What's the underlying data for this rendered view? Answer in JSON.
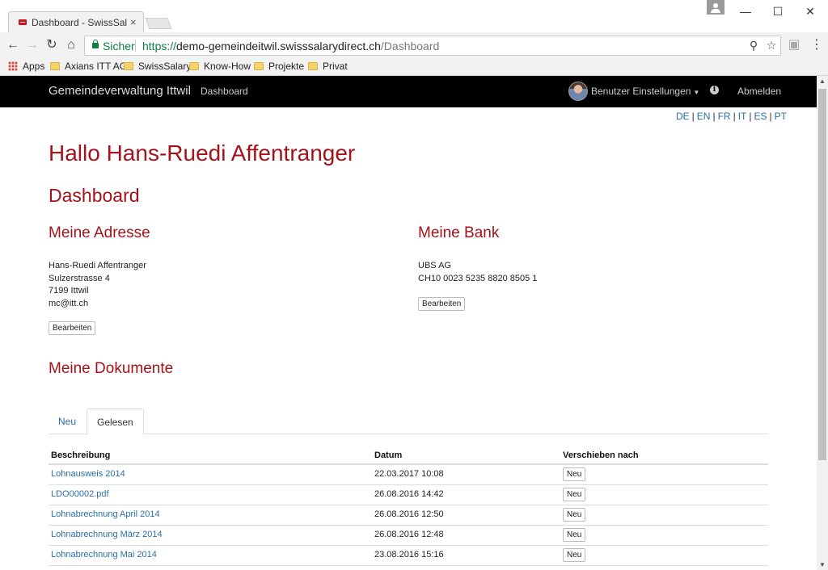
{
  "browser": {
    "tab_title": "Dashboard - SwissSalary",
    "tab_close": "×",
    "url_secure_label": "Sicher",
    "url_protocol": "https://",
    "url_host": "demo-gemeindeitwil.swisssalarydirect.ch",
    "url_path": "/Dashboard",
    "bookmarks": [
      "Apps",
      "Axians ITT AG",
      "SwissSalary",
      "Know-How",
      "Projekte",
      "Privat"
    ]
  },
  "navbar": {
    "brand": "Gemeindeverwaltung Ittwil",
    "dashboard_link": "Dashboard",
    "user_settings": "Benutzer Einstellungen",
    "logout": "Abmelden"
  },
  "languages": [
    "DE",
    "EN",
    "FR",
    "IT",
    "ES",
    "PT"
  ],
  "greeting": "Hallo Hans-Ruedi Affentranger",
  "page_title": "Dashboard",
  "address": {
    "heading": "Meine Adresse",
    "name": "Hans-Ruedi Affentranger",
    "street": "Sulzerstrasse 4",
    "city": "7199 Ittwil",
    "email": "mc@itt.ch",
    "edit_label": "Bearbeiten"
  },
  "bank": {
    "heading": "Meine Bank",
    "name": "UBS AG",
    "iban": "CH10 0023 5235 8820 8505 1",
    "edit_label": "Bearbeiten"
  },
  "documents": {
    "heading": "Meine Dokumente",
    "tabs": [
      "Neu",
      "Gelesen"
    ],
    "active_tab": "Gelesen",
    "columns": [
      "Beschreibung",
      "Datum",
      "Verschieben nach"
    ],
    "rows": [
      {
        "description": "Lohnausweis 2014",
        "date": "22.03.2017 10:08",
        "move": "Neu"
      },
      {
        "description": "LDO00002.pdf",
        "date": "26.08.2016 14:42",
        "move": "Neu"
      },
      {
        "description": "Lohnabrechnung April 2014",
        "date": "26.08.2016 12:50",
        "move": "Neu"
      },
      {
        "description": "Lohnabrechnung März 2014",
        "date": "26.08.2016 12:48",
        "move": "Neu"
      },
      {
        "description": "Lohnabrechnung Mai 2014",
        "date": "23.08.2016 15:16",
        "move": "Neu"
      }
    ]
  }
}
